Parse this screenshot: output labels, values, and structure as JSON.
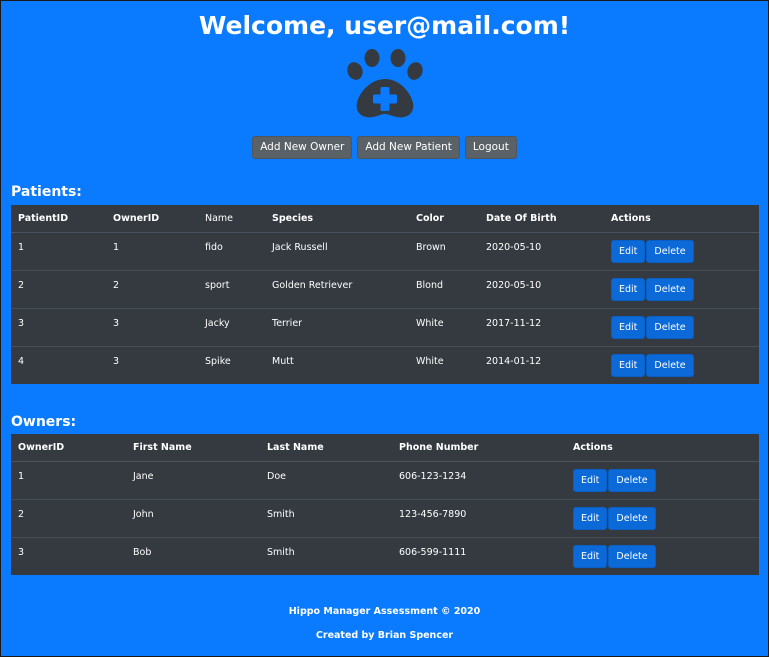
{
  "header": {
    "welcome": "Welcome, user@mail.com!"
  },
  "toolbar": {
    "add_owner_label": "Add New Owner",
    "add_patient_label": "Add New Patient",
    "logout_label": "Logout"
  },
  "patients": {
    "heading": "Patients:",
    "columns": [
      "PatientID",
      "OwnerID",
      "Name",
      "Species",
      "Color",
      "Date Of Birth",
      "Actions"
    ],
    "rows": [
      {
        "patient_id": "1",
        "owner_id": "1",
        "name": "fido",
        "species": "Jack Russell",
        "color": "Brown",
        "dob": "2020-05-10"
      },
      {
        "patient_id": "2",
        "owner_id": "2",
        "name": "sport",
        "species": "Golden Retriever",
        "color": "Blond",
        "dob": "2020-05-10"
      },
      {
        "patient_id": "3",
        "owner_id": "3",
        "name": "Jacky",
        "species": "Terrier",
        "color": "White",
        "dob": "2017-11-12"
      },
      {
        "patient_id": "4",
        "owner_id": "3",
        "name": "Spike",
        "species": "Mutt",
        "color": "White",
        "dob": "2014-01-12"
      }
    ]
  },
  "owners": {
    "heading": "Owners:",
    "columns": [
      "OwnerID",
      "First Name",
      "Last Name",
      "Phone Number",
      "Actions"
    ],
    "rows": [
      {
        "owner_id": "1",
        "first_name": "Jane",
        "last_name": "Doe",
        "phone": "606-123-1234"
      },
      {
        "owner_id": "2",
        "first_name": "John",
        "last_name": "Smith",
        "phone": "123-456-7890"
      },
      {
        "owner_id": "3",
        "first_name": "Bob",
        "last_name": "Smith",
        "phone": "606-599-1111"
      }
    ]
  },
  "actions": {
    "edit_label": "Edit",
    "delete_label": "Delete"
  },
  "footer": {
    "copyright": "Hippo Manager Assessment © 2020",
    "credit": "Created by Brian Spencer"
  },
  "colors": {
    "background": "#0a7bff",
    "table": "#343a40",
    "grey_button": "#5a6268",
    "blue_button": "#0b6ad8",
    "logo": "#343a40"
  },
  "icons": {
    "logo": "paw-plus-icon"
  }
}
